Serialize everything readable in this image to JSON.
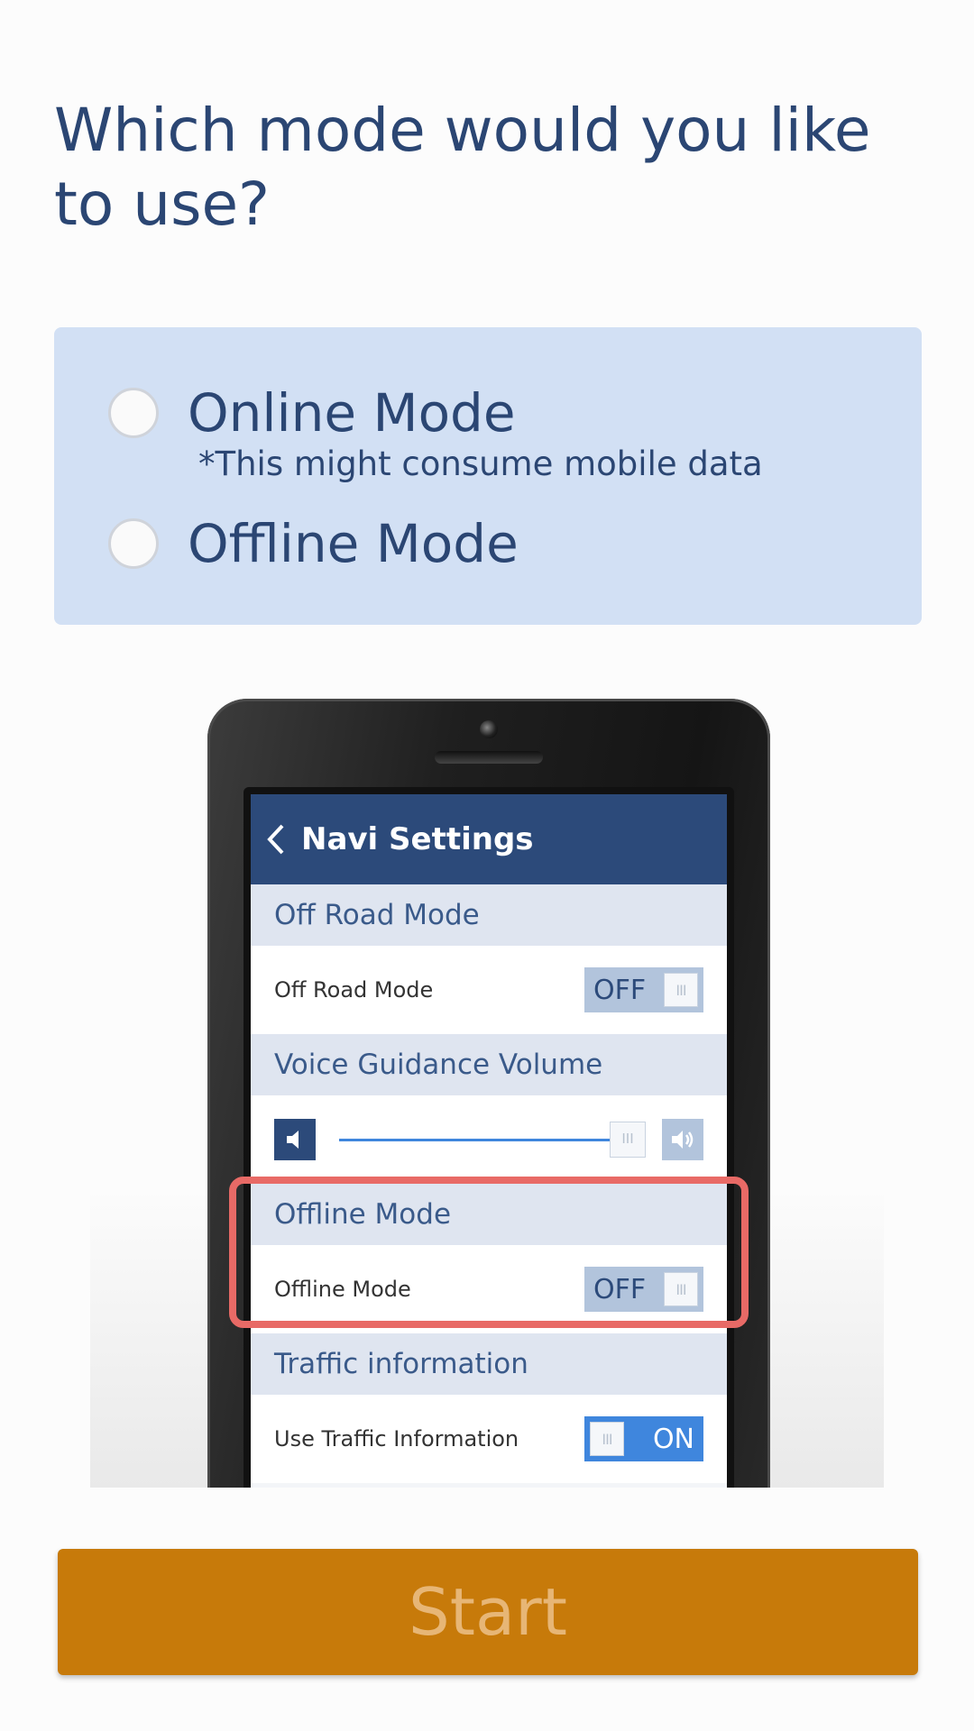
{
  "question": "Which mode would you like to use?",
  "options": [
    {
      "label": "Online Mode",
      "note": "*This might consume mobile data",
      "selected": false
    },
    {
      "label": "Offline Mode",
      "selected": false
    }
  ],
  "illustration": {
    "title": "Navi Settings",
    "sections": {
      "off_road": {
        "header": "Off Road Mode",
        "row_label": "Off Road Mode",
        "toggle": "OFF"
      },
      "voice": {
        "header": "Voice Guidance Volume",
        "volume_level": 0.95
      },
      "offline": {
        "header": "Offline Mode",
        "row_label": "Offline Mode",
        "toggle": "OFF"
      },
      "traffic": {
        "header": "Traffic information",
        "row_label": "Use Traffic Information",
        "toggle": "ON"
      }
    },
    "thumb_glyph": "III",
    "highlight_color": "#e86a66"
  },
  "start_button": "Start",
  "colors": {
    "accent": "#c77a0a",
    "text": "#2b4673",
    "panel": "#d2e0f4",
    "nav": "#2c4a7a",
    "toggle_on": "#3f86dd"
  }
}
